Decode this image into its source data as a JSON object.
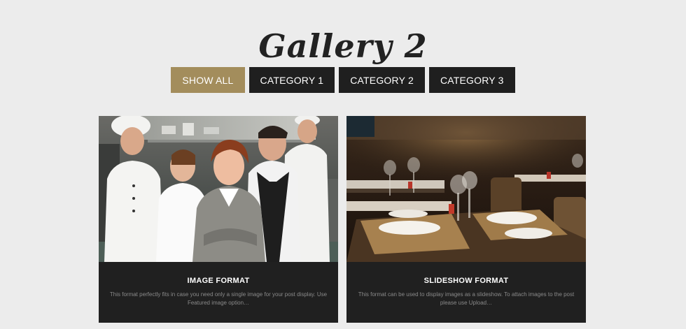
{
  "gallery": {
    "title": "Gallery 2"
  },
  "filters": [
    {
      "label": "SHOW ALL",
      "active": true
    },
    {
      "label": "CATEGORY 1",
      "active": false
    },
    {
      "label": "CATEGORY 2",
      "active": false
    },
    {
      "label": "CATEGORY 3",
      "active": false
    }
  ],
  "posts": [
    {
      "title": "IMAGE FORMAT",
      "excerpt": "This format perfectly fits in case you need only a single image for your post display. Use Featured image option…"
    },
    {
      "title": "SLIDESHOW FORMAT",
      "excerpt": "This format can be used to display images as a slideshow. To attach images to the post please use Upload…"
    }
  ],
  "colors": {
    "background": "#ececec",
    "accent": "#a38d5c",
    "button": "#1f1f1f",
    "card": "#202020"
  }
}
